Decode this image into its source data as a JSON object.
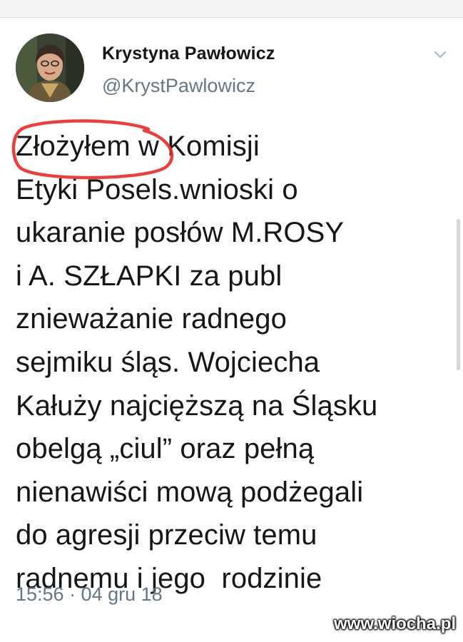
{
  "author": {
    "name": "Krystyna Pawłowicz",
    "handle": "@KrystPawlowicz"
  },
  "icons": {
    "menu": "chevron-down-icon",
    "avatar": "avatar"
  },
  "tweet": {
    "lines": [
      "Złożyłem w Komisji",
      "Etyki Posels.wnioski o",
      "ukaranie posłów M.ROSY",
      "i A. SZŁAPKI za publ",
      "znieważanie radnego",
      "sejmiku śląs. Wojciecha",
      "Kałuży najcięższą na Śląsku",
      "obelgą „ciul” oraz pełną",
      "nienawiści mową podżegali",
      "do agresji przeciw temu",
      "radnemu i jego  rodzinie"
    ],
    "timestamp": "15:56 · 04 gru 18"
  },
  "watermark": "www.wiocha.pl",
  "colors": {
    "text": "#14171a",
    "secondary": "#657786",
    "highlight": "#e8302c"
  }
}
